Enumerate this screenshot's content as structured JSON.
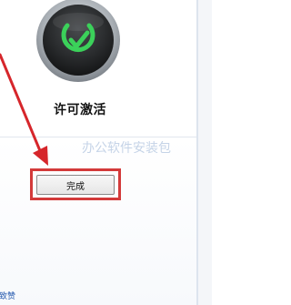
{
  "emblem": {
    "label": "许可激活",
    "icon": "license-check-icon",
    "ring_color": "#9aa0a6",
    "disk_color": "#2a2c2e",
    "check_color": "#3bd15a"
  },
  "watermark": {
    "text": "办公软件安装包"
  },
  "actions": {
    "finish_label": "完成",
    "highlight_color": "#d33a3a"
  },
  "footer": {
    "link_fragment": "致赞"
  },
  "annotation": {
    "arrow_icon": "red-arrow-icon"
  }
}
